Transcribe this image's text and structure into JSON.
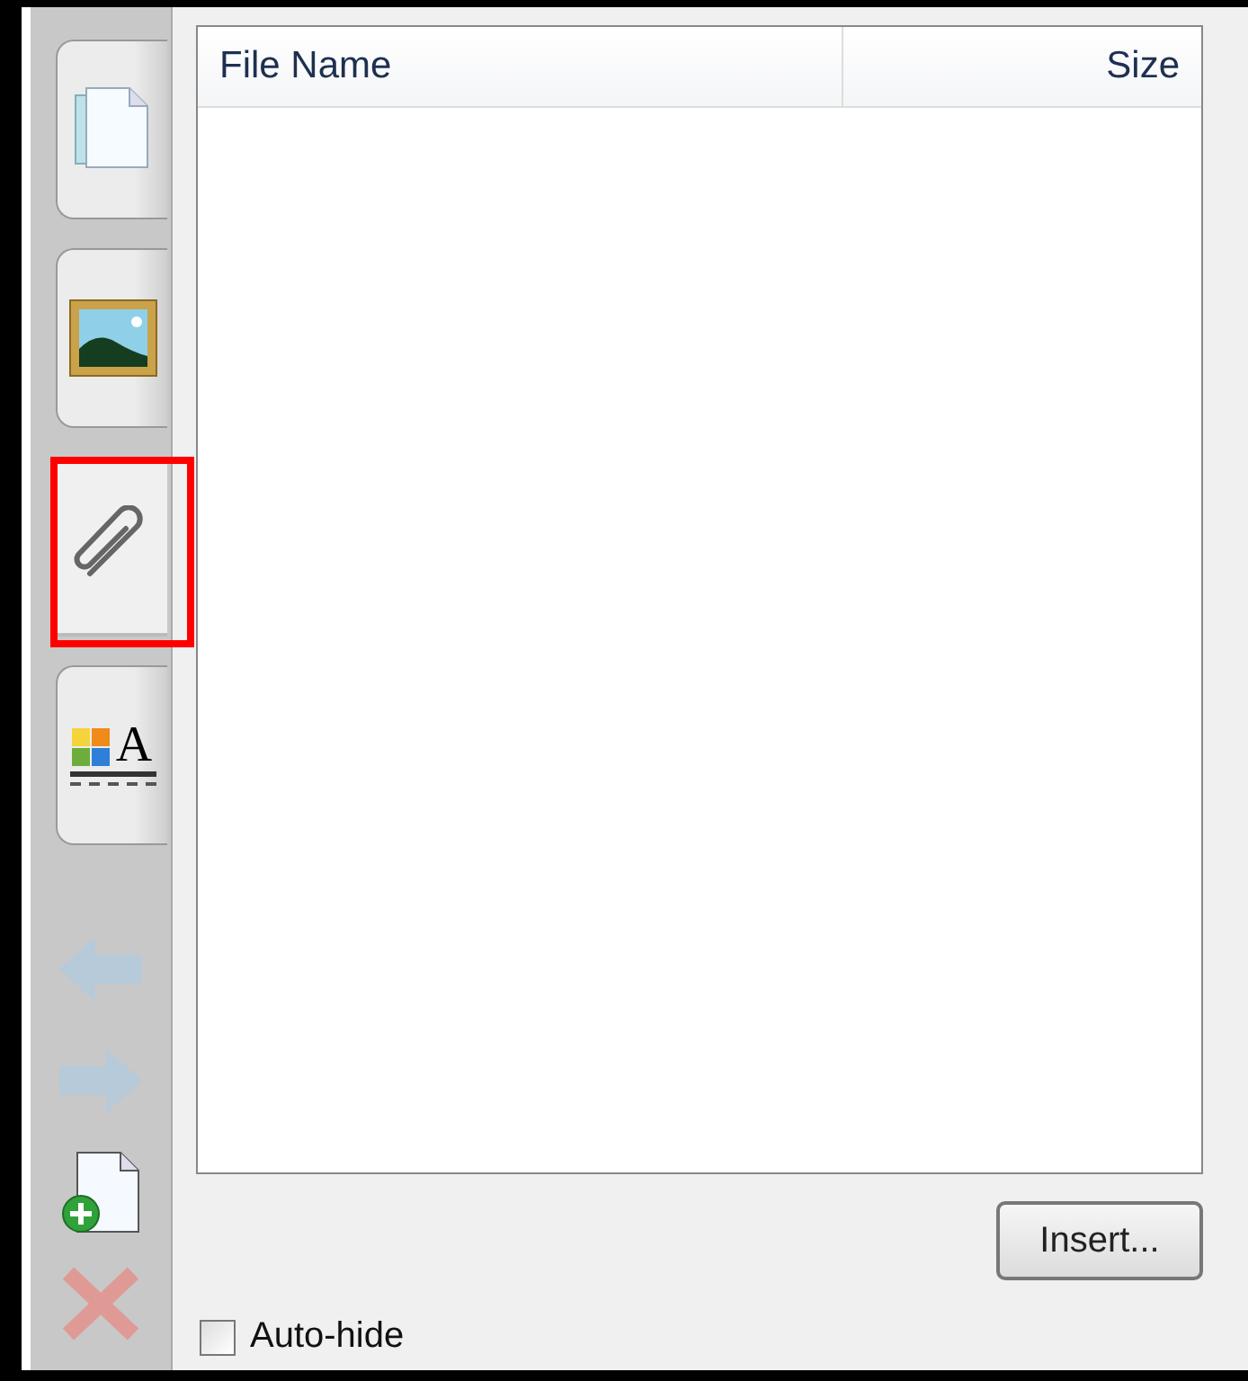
{
  "sidebar": {
    "tabs": [
      {
        "kind": "pages",
        "selected": false,
        "highlighted": false
      },
      {
        "kind": "picture",
        "selected": false,
        "highlighted": false
      },
      {
        "kind": "paperclip",
        "selected": true,
        "highlighted": true
      },
      {
        "kind": "text-style",
        "glyph": "A",
        "selected": false,
        "highlighted": false
      }
    ],
    "actions": [
      {
        "kind": "back",
        "disabled": true
      },
      {
        "kind": "forward",
        "disabled": true
      },
      {
        "kind": "add-page",
        "disabled": false
      },
      {
        "kind": "delete",
        "disabled": true
      }
    ]
  },
  "table": {
    "columns": [
      "File Name",
      "Size"
    ]
  },
  "insert_button": "Insert...",
  "auto_hide": {
    "label": "Auto-hide",
    "checked": false
  }
}
